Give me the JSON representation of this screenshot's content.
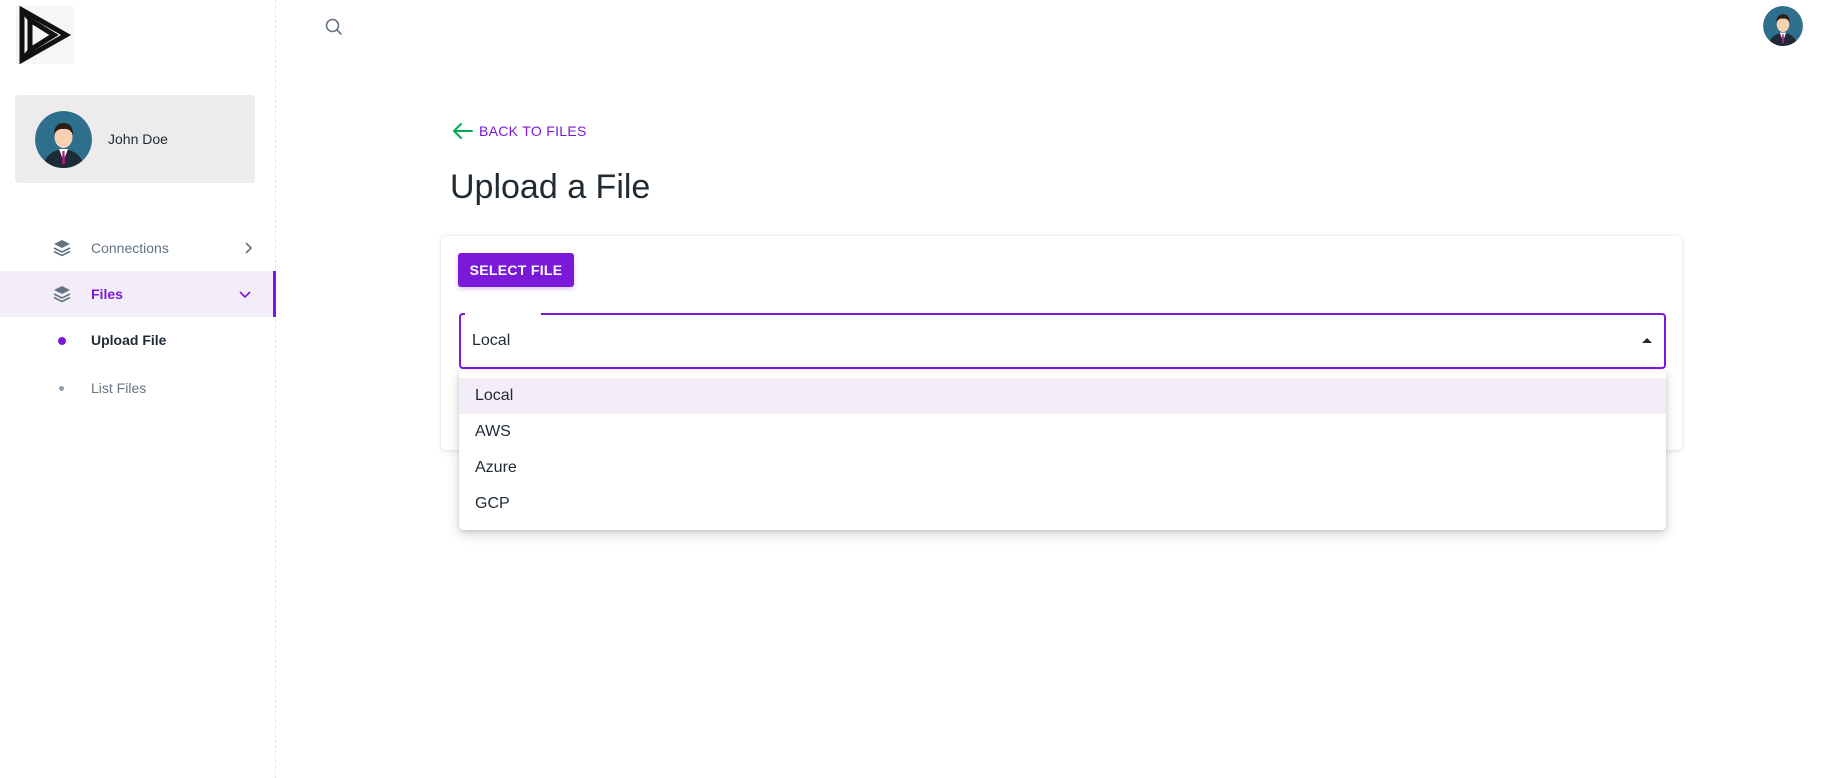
{
  "user": {
    "name": "John Doe"
  },
  "sidebar": {
    "items": [
      {
        "label": "Connections",
        "icon": "layers-icon",
        "expanded": false,
        "active": false
      },
      {
        "label": "Files",
        "icon": "layers-icon",
        "expanded": true,
        "active": true
      }
    ],
    "sub_items": [
      {
        "label": "Upload File",
        "active": true
      },
      {
        "label": "List Files",
        "active": false
      }
    ]
  },
  "header": {
    "search_icon": "search-icon"
  },
  "main": {
    "back_label": "BACK TO FILES",
    "title": "Upload a File",
    "select_file_label": "SELECT FILE",
    "storage": {
      "selected": "Local",
      "options": [
        "Local",
        "AWS",
        "Azure",
        "GCP"
      ]
    }
  },
  "colors": {
    "accent": "#7b19d8",
    "back_arrow": "#00ab55",
    "selected_bg": "#f3edf9"
  }
}
